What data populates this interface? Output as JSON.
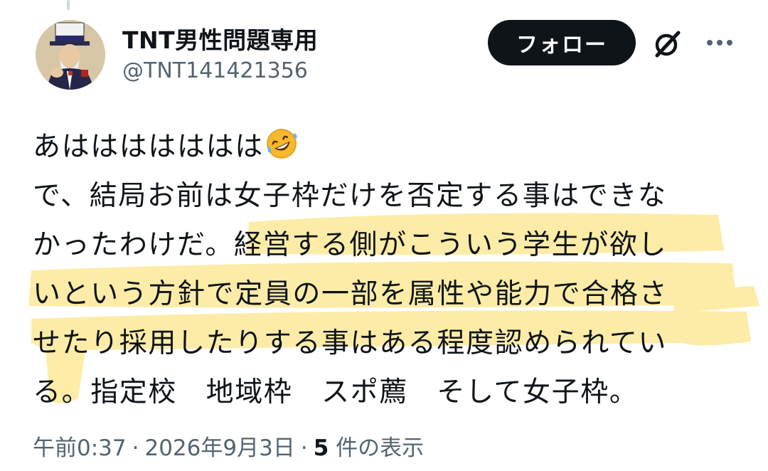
{
  "tweet": {
    "author": {
      "display_name": "TNT男性問題専用",
      "handle": "@TNT141421356",
      "avatar_icon": "uncle-sam-avatar"
    },
    "follow_label": "フォロー",
    "icons": {
      "grok": "grok-icon",
      "more": "more-options-icon"
    },
    "text_lines": [
      "あははははははは",
      "で、結局お前は女子枠だけを否定する事はできな",
      "かったわけだ。経営する側がこういう学生が欲し",
      "いという方針で定員の一部を属性や能力で合格さ",
      "せたり採用したりする事はある程度認められてい",
      "る。指定校　地域枠　スポ薦　そして女子枠。"
    ],
    "emoji": "rolling-on-floor-laughing",
    "meta": {
      "time": "午前0:37",
      "date": "2026年9月3日",
      "views_count": "5",
      "views_label": "件の表示"
    },
    "colors": {
      "text": "#0f1419",
      "secondary": "#536471",
      "follow_bg": "#0f1419",
      "highlight": "#fde68a"
    }
  }
}
